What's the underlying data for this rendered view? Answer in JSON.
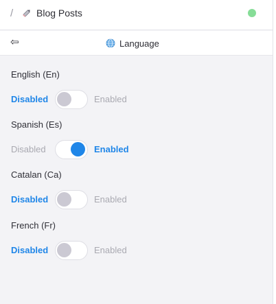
{
  "header": {
    "breadcrumb_sep": "/",
    "title": "Blog Posts",
    "status_color": "#86dd97"
  },
  "panel": {
    "title": "Language"
  },
  "languages": [
    {
      "name": "English (En)",
      "off_label": "Disabled",
      "on_label": "Enabled",
      "enabled": false
    },
    {
      "name": "Spanish (Es)",
      "off_label": "Disabled",
      "on_label": "Enabled",
      "enabled": true
    },
    {
      "name": "Catalan (Ca)",
      "off_label": "Disabled",
      "on_label": "Enabled",
      "enabled": false
    },
    {
      "name": "French (Fr)",
      "off_label": "Disabled",
      "on_label": "Enabled",
      "enabled": false
    }
  ],
  "colors": {
    "accent": "#1f86e8",
    "muted": "#a9a9b1",
    "knob_off": "#cbc9d3"
  }
}
